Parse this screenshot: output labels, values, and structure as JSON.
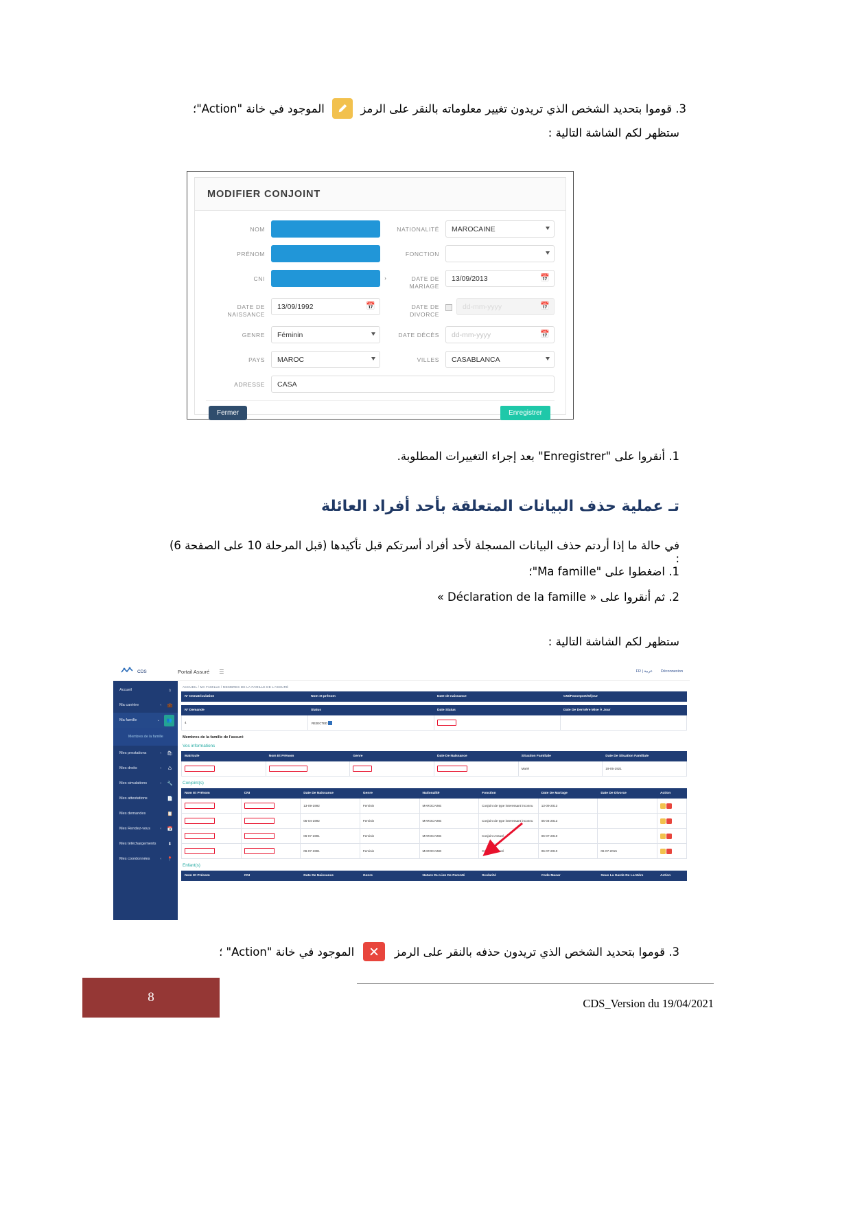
{
  "document": {
    "page_number": "8",
    "footer_right": "CDS_Version du 19/04/2021"
  },
  "top_step": {
    "number": "3.",
    "text_before_icon": "قوموا بتحديد الشخص الذي تريدون تغيير معلوماته بالنقر على الرمز",
    "icon": "pencil-icon",
    "text_after_icon": "الموجود في خانة \"Action\"؛",
    "next_line": "ستظهر لكم الشاشة التالية :"
  },
  "modify_form": {
    "title": "MODIFIER CONJOINT",
    "fields": {
      "nom_label": "NOM",
      "nom_value": "",
      "prenom_label": "PRÉNOM",
      "prenom_value": "",
      "cni_label": "CNI",
      "cni_value": "",
      "date_naissance_label": "DATE DE NAISSANCE",
      "date_naissance_value": "13/09/1992",
      "genre_label": "GENRE",
      "genre_value": "Féminin",
      "pays_label": "PAYS",
      "pays_value": "MAROC",
      "adresse_label": "ADRESSE",
      "adresse_value": "CASA",
      "nationalite_label": "NATIONALITÉ",
      "nationalite_value": "MAROCAINE",
      "fonction_label": "FONCTION",
      "fonction_value": "",
      "date_mariage_label": "DATE DE MARIAGE",
      "date_mariage_value": "13/09/2013",
      "date_divorce_label": "DATE DE DIVORCE",
      "date_divorce_placeholder": "dd-mm-yyyy",
      "date_deces_label": "DATE DÉCÈS",
      "date_deces_placeholder": "dd-mm-yyyy",
      "villes_label": "VILLES",
      "villes_value": "CASABLANCA"
    },
    "buttons": {
      "close": "Fermer",
      "save": "Enregistrer"
    },
    "colors": {
      "highlight": "#2196d8",
      "save": "#1fc8a9",
      "close": "#2f4d6d"
    }
  },
  "save_step": {
    "number": "1.",
    "text": "أنقروا على \"Enregistrer\" بعد إجراء التغييرات المطلوبة."
  },
  "section": {
    "heading": "ت‪ـ عملية حذف البيانات المتعلقة بأحد أفراد العائلة",
    "heading_color": "#1f3864",
    "intro": "في حالة ما إذا أردتم حذف البيانات المسجلة لأحد أفراد أسرتكم قبل تأكيدها (قبل المرحلة 10 على الصفحة 6) :",
    "item1": "1.   اضغطوا على \"Ma famille\"؛",
    "item2": "2.   ثم أنقروا على « Déclaration de la famille »",
    "screen_follows": "ستظهر لكم الشاشة التالية :"
  },
  "app": {
    "topbar": {
      "brand": "CDS",
      "portal_title": "Portail Assuré",
      "menu_icon": "hamburger-icon",
      "lang": "FR | عربية",
      "logout": "Déconnexion"
    },
    "sidebar": {
      "items": [
        {
          "label": "Accueil",
          "icon": "home-icon",
          "chevron": false,
          "active": false
        },
        {
          "label": "Ma carrière",
          "icon": "briefcase-icon",
          "chevron": true,
          "active": false
        },
        {
          "label": "Ma famille",
          "icon": "users-icon",
          "chevron": true,
          "active": true
        },
        {
          "label": "Mes prestations",
          "icon": "bag-icon",
          "chevron": true,
          "active": false
        },
        {
          "label": "Mes droits",
          "icon": "shield-icon",
          "chevron": true,
          "active": false
        },
        {
          "label": "Mes simulations",
          "icon": "wrench-icon",
          "chevron": true,
          "active": false
        },
        {
          "label": "Mes attestations",
          "icon": "document-icon",
          "chevron": false,
          "active": false
        },
        {
          "label": "Mes demandes",
          "icon": "list-icon",
          "chevron": false,
          "active": false
        },
        {
          "label": "Mes Rendez-vous",
          "icon": "calendar-icon",
          "chevron": true,
          "active": false
        },
        {
          "label": "Mes téléchargements",
          "icon": "download-icon",
          "chevron": false,
          "active": false
        },
        {
          "label": "Mes coordonnées",
          "icon": "pin-icon",
          "chevron": true,
          "active": false
        }
      ],
      "submenu": "Membres de la famille"
    },
    "breadcrumb": "ACCUEIL / MA FAMILLE / MEMBRES DE LA FAMILLE DE L'ASSURÉ",
    "immat_table": {
      "headers": [
        "N° Immatriculation",
        "Nom et prénom",
        "Date de naissance",
        "CNI/Passeport/Séjour"
      ],
      "rows": [
        [
          "",
          "",
          "",
          ""
        ]
      ]
    },
    "demande_table": {
      "headers": [
        "N° Demande",
        "Status",
        "Date Status",
        "Date De Dernière Mise À Jour"
      ],
      "rows": [
        [
          "4",
          "REJECTED",
          "",
          ""
        ]
      ]
    },
    "section_title": "Membres de la famille de l'assuré",
    "vos_infos": {
      "title": "Vos informations",
      "headers": [
        "Matricule",
        "Nom Et Prénom",
        "Genre",
        "Date De Naissance",
        "Situation Familiale",
        "Date De Situation Familiale"
      ],
      "rows": [
        [
          "",
          "",
          "",
          "",
          "Marié",
          "19-05-1921"
        ]
      ]
    },
    "conjoints": {
      "title": "Conjoint(s)",
      "headers": [
        "Nom Et Prénom",
        "CNI",
        "Date De Naissance",
        "Genre",
        "Nationalité",
        "Fonction",
        "Date De Mariage",
        "Date De Divorce",
        "Action"
      ],
      "rows": [
        {
          "nom": "",
          "cni": "",
          "naissance": "13-09-1992",
          "genre": "Feminin",
          "nationalite": "MAROCAINE",
          "fonction": "Conjoint de type interessant inconnu",
          "mariage": "13-09-2013",
          "divorce": "",
          "actions": [
            "edit-icon",
            "delete-icon"
          ]
        },
        {
          "nom": "",
          "cni": "",
          "naissance": "05-04-1992",
          "genre": "Feminin",
          "nationalite": "MAROCAINE",
          "fonction": "Conjoint de type interessant inconnu",
          "mariage": "05-04-2013",
          "divorce": "",
          "actions": [
            "edit-icon",
            "delete-icon"
          ]
        },
        {
          "nom": "",
          "cni": "",
          "naissance": "06-07-1991",
          "genre": "Feminin",
          "nationalite": "MAROCAINE",
          "fonction": "Conjoint Assuré",
          "mariage": "06-07-2010",
          "divorce": "",
          "actions": [
            "edit-icon",
            "delete-icon"
          ]
        },
        {
          "nom": "",
          "cni": "",
          "naissance": "06-07-1991",
          "genre": "Feminin",
          "nationalite": "MAROCAINE",
          "fonction": "Conjoint Assuré",
          "mariage": "06-07-2010",
          "divorce": "06-07-2015",
          "actions": [
            "edit-icon",
            "delete-icon"
          ]
        }
      ]
    },
    "enfants": {
      "title": "Enfant(s)",
      "headers": [
        "Nom Et Prénom",
        "CNI",
        "Date De Naissance",
        "Genre",
        "Nature Du Lien De Parenté",
        "Scolarité",
        "Code Masar",
        "Sous La Garde De La Mère",
        "Action"
      ]
    }
  },
  "bottom_step": {
    "number": "3.",
    "text_before_icon": "قوموا بتحديد الشخص الذي تريدون حذفه بالنقر على الرمز",
    "icon": "delete-x-icon",
    "text_after_icon": "الموجود في خانة \"Action\" ؛"
  }
}
